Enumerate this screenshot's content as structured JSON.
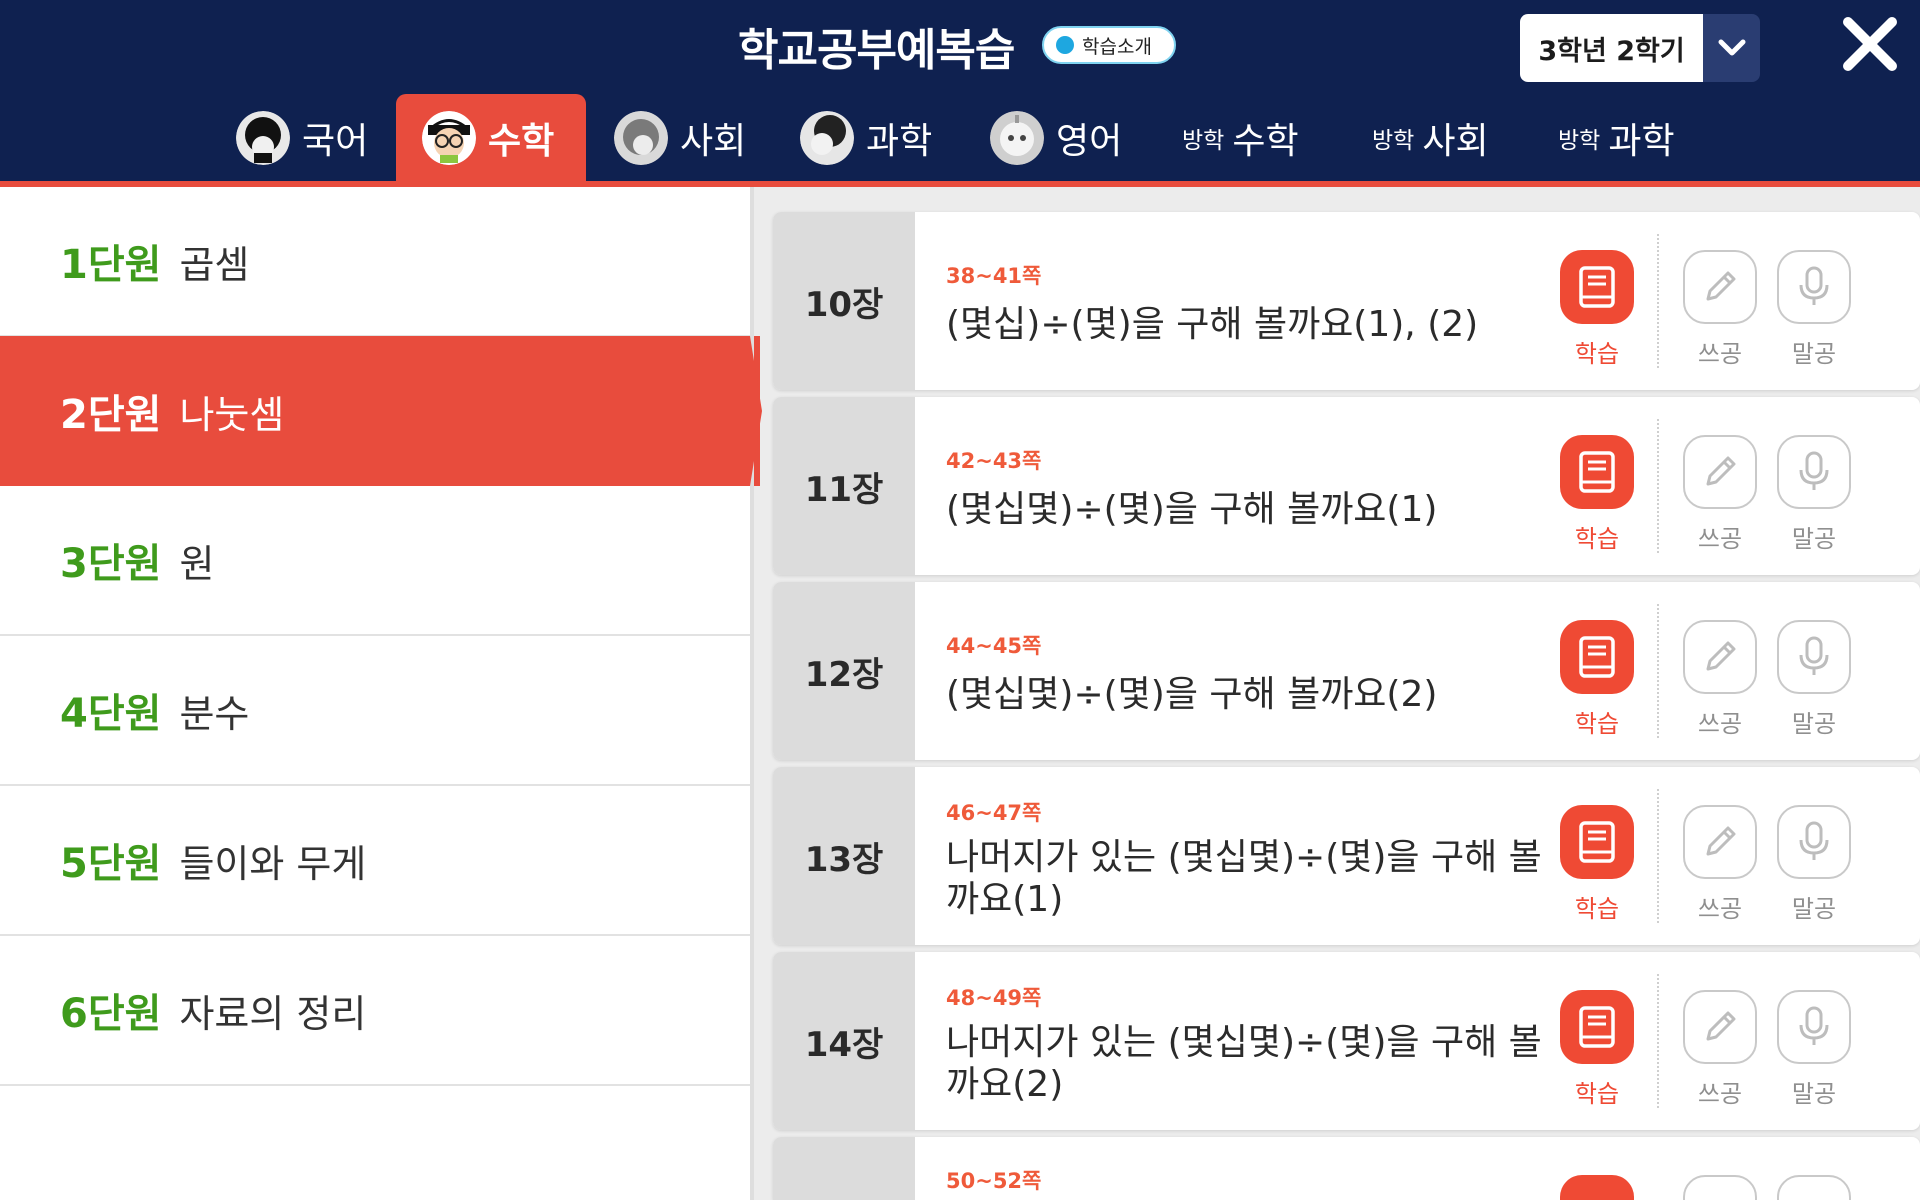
{
  "header": {
    "title": "학교공부예복습",
    "intro_badge": "학습소개",
    "grade_select": "3학년 2학기"
  },
  "tabs": [
    {
      "label": "국어",
      "icon": "korean-character-avatar"
    },
    {
      "label": "수학",
      "icon": "math-character-avatar",
      "active": true
    },
    {
      "label": "사회",
      "icon": "social-character-avatar"
    },
    {
      "label": "과학",
      "icon": "science-character-avatar"
    },
    {
      "label": "영어",
      "icon": "english-robot-avatar"
    },
    {
      "sub": "방학",
      "label": "수학"
    },
    {
      "sub": "방학",
      "label": "사회"
    },
    {
      "sub": "방학",
      "label": "과학"
    }
  ],
  "units": [
    {
      "no": "1단원",
      "name": "곱셈"
    },
    {
      "no": "2단원",
      "name": "나눗셈",
      "active": true
    },
    {
      "no": "3단원",
      "name": "원"
    },
    {
      "no": "4단원",
      "name": "분수"
    },
    {
      "no": "5단원",
      "name": "들이와 무게"
    },
    {
      "no": "6단원",
      "name": "자료의 정리"
    }
  ],
  "chapters": [
    {
      "chapter": "10장",
      "pages": "38~41쪽",
      "title": "(몇십)÷(몇)을 구해 볼까요(1), (2)"
    },
    {
      "chapter": "11장",
      "pages": "42~43쪽",
      "title": "(몇십몇)÷(몇)을 구해 볼까요(1)"
    },
    {
      "chapter": "12장",
      "pages": "44~45쪽",
      "title": "(몇십몇)÷(몇)을 구해 볼까요(2)"
    },
    {
      "chapter": "13장",
      "pages": "46~47쪽",
      "title": "나머지가 있는 (몇십몇)÷(몇)을 구해 볼까요(1)"
    },
    {
      "chapter": "14장",
      "pages": "48~49쪽",
      "title": "나머지가 있는 (몇십몇)÷(몇)을 구해 볼까요(2)"
    },
    {
      "chapter": "",
      "pages": "50~52쪽",
      "title": ""
    }
  ],
  "buttons": {
    "study": "학습",
    "write": "쓰공",
    "speak": "말공"
  },
  "colors": {
    "header_bg": "#0f2150",
    "accent": "#e84c3d",
    "unit_number": "#3f9b1c"
  }
}
